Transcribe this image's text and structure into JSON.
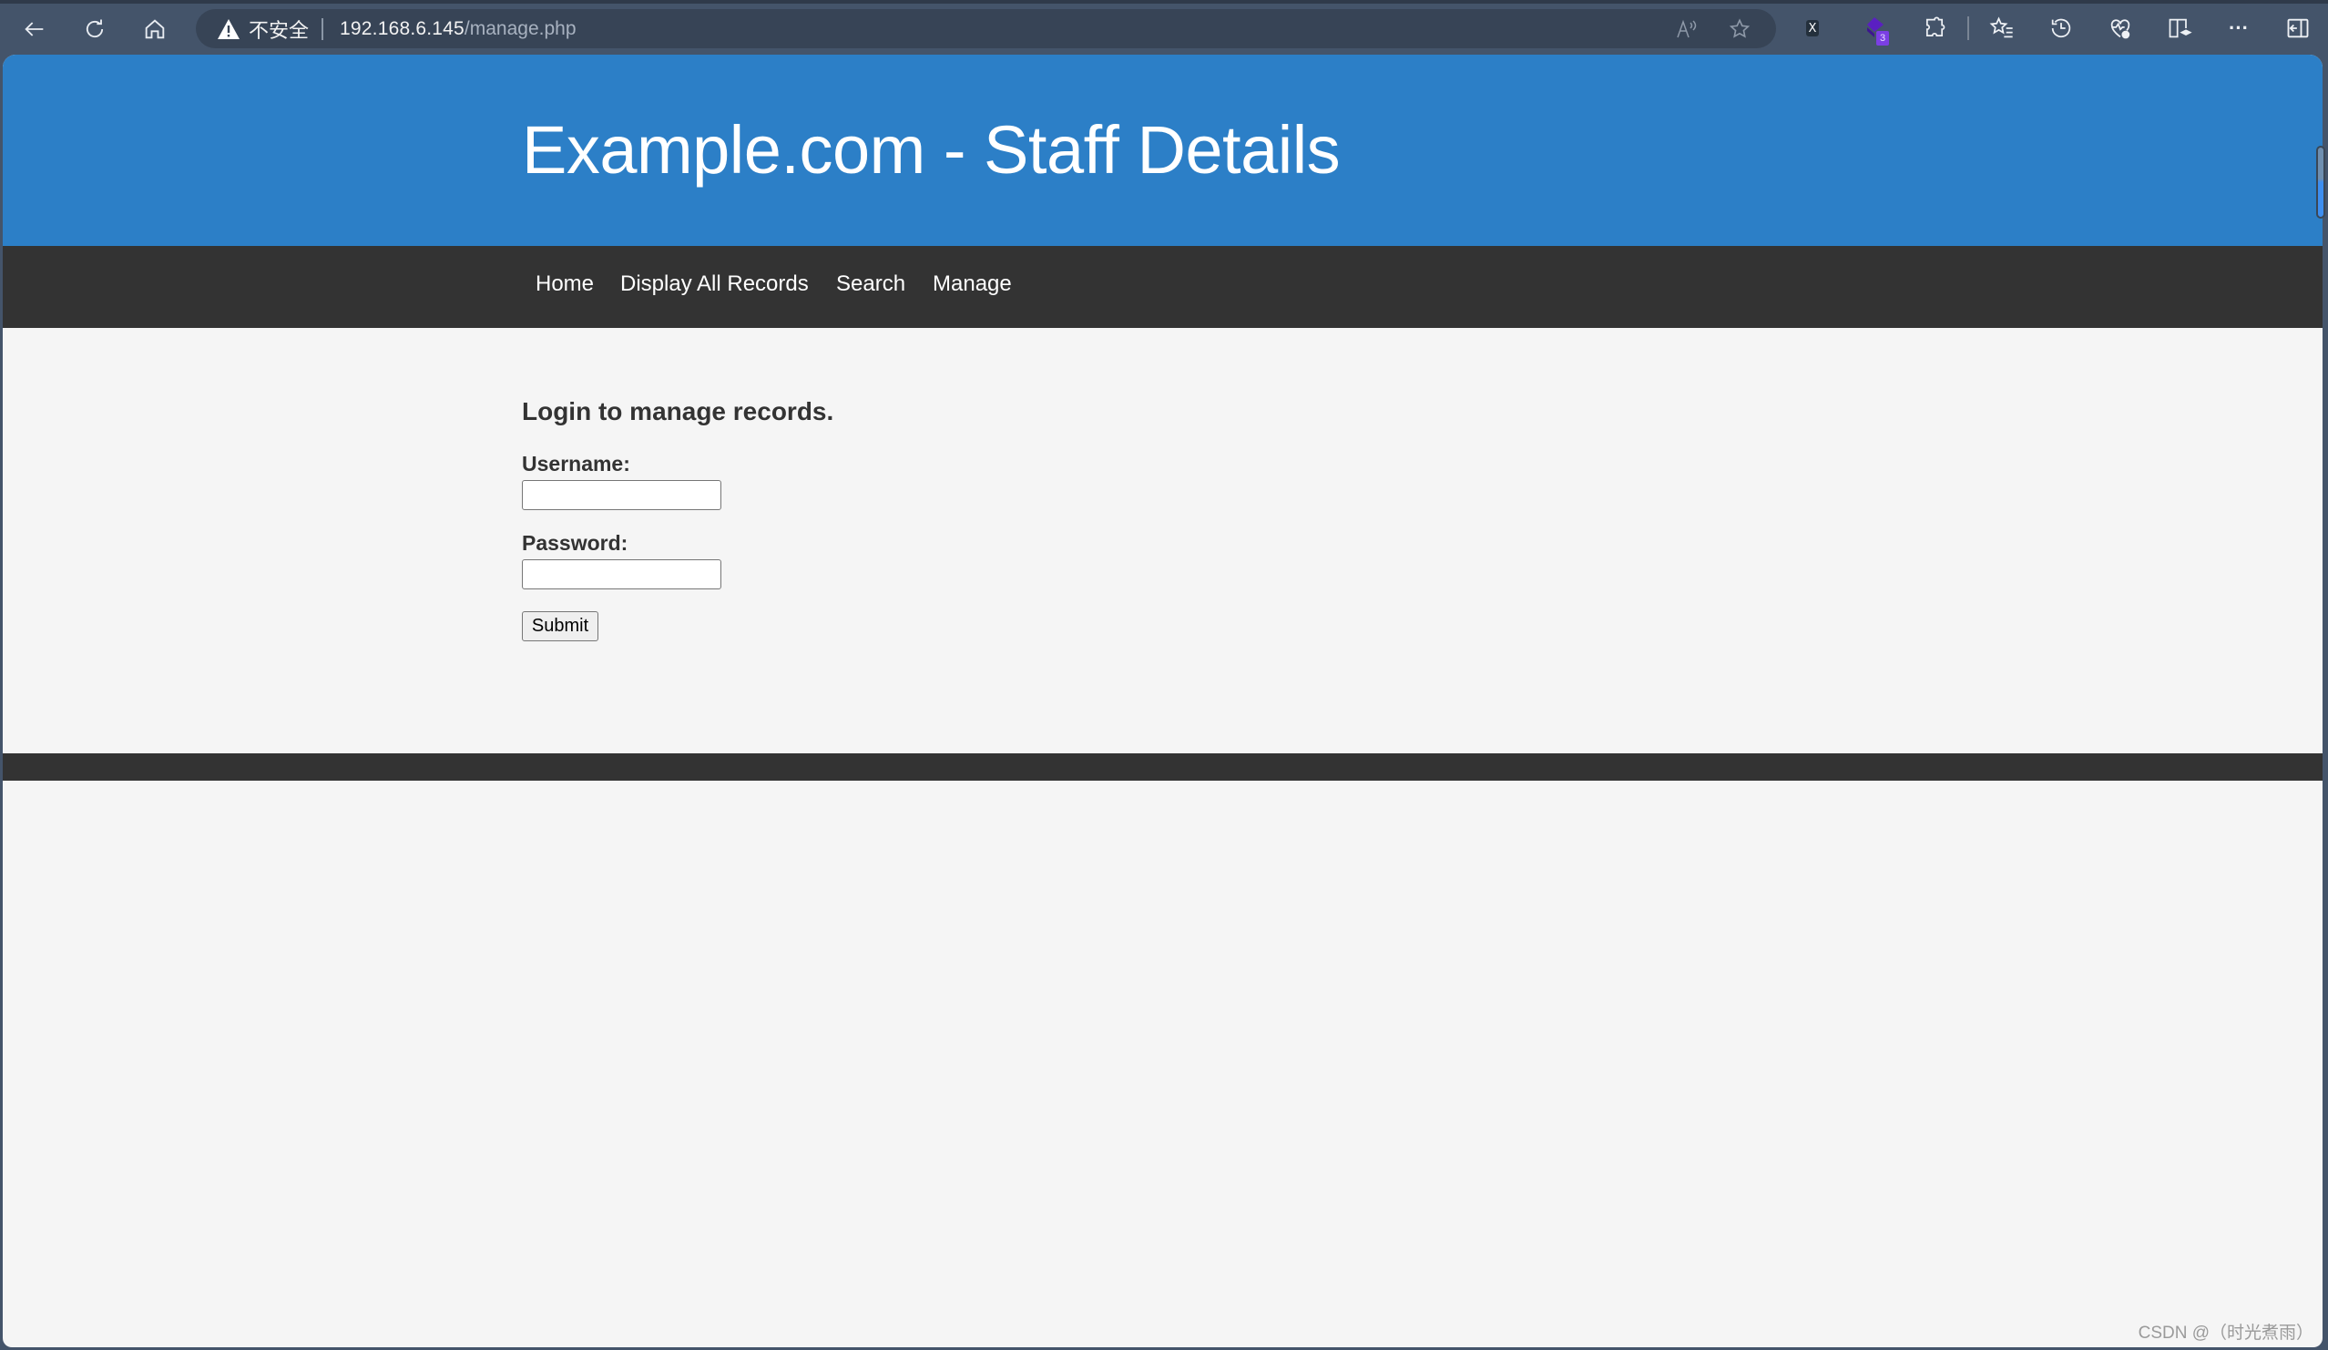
{
  "browser": {
    "security_label": "不安全",
    "url_host": "192.168.6.145",
    "url_path": "/manage.php",
    "toolbar_icons": [
      "read-aloud-icon",
      "favorite-star-icon",
      "extension-x-icon",
      "extension-cube-icon",
      "extensions-puzzle-icon",
      "favorites-list-icon",
      "history-icon",
      "browser-health-icon",
      "reading-view-icon",
      "more-menu-icon",
      "sidebar-toggle-icon"
    ],
    "extension_badge": "3",
    "extension_x_label": "X",
    "more_label": "···"
  },
  "site": {
    "title": "Example.com - Staff Details",
    "header_color": "#2c7fc7",
    "nav_color": "#333333",
    "nav": [
      {
        "label": "Home"
      },
      {
        "label": "Display All Records"
      },
      {
        "label": "Search"
      },
      {
        "label": "Manage"
      }
    ]
  },
  "login": {
    "heading": "Login to manage records.",
    "username_label": "Username:",
    "username_value": "",
    "password_label": "Password:",
    "password_value": "",
    "submit_label": "Submit"
  },
  "watermark": "CSDN @（时光煮雨）"
}
